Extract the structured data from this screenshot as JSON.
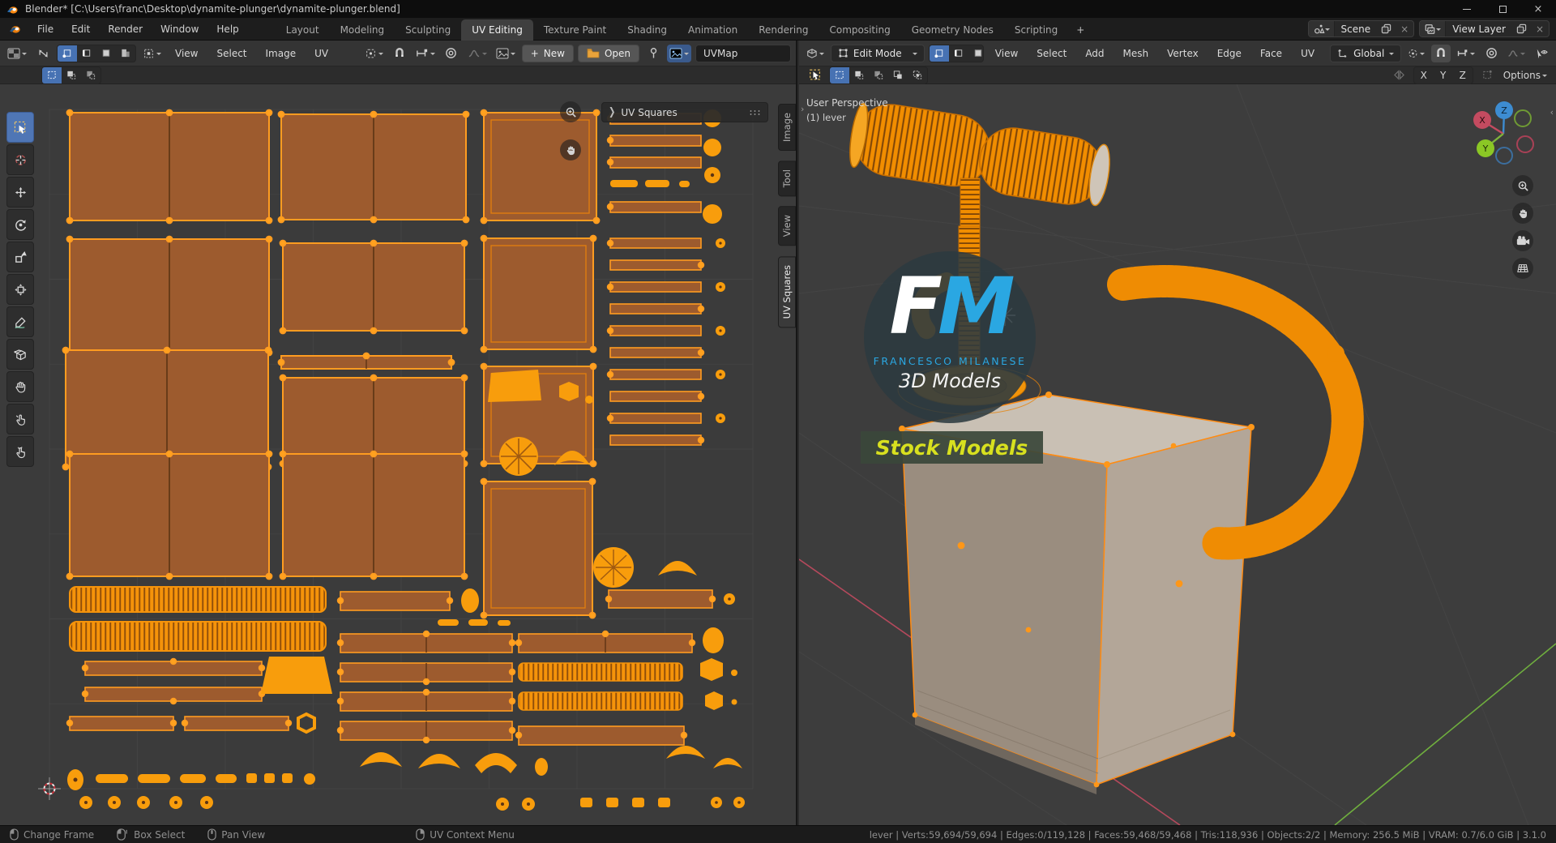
{
  "window": {
    "title": "Blender* [C:\\Users\\franc\\Desktop\\dynamite-plunger\\dynamite-plunger.blend]",
    "minimize": "–",
    "maximize": "",
    "close": "×"
  },
  "topbar": {
    "menus": [
      "File",
      "Edit",
      "Render",
      "Window",
      "Help"
    ],
    "workspaces": [
      "Layout",
      "Modeling",
      "Sculpting",
      "UV Editing",
      "Texture Paint",
      "Shading",
      "Animation",
      "Rendering",
      "Compositing",
      "Geometry Nodes",
      "Scripting"
    ],
    "active_workspace": "UV Editing",
    "add_workspace": "+",
    "scene_label": "Scene",
    "view_layer_label": "View Layer",
    "close_x": "×"
  },
  "uv_editor": {
    "menus": [
      "View",
      "Select",
      "Image",
      "UV"
    ],
    "new_label": "New",
    "plus": "+",
    "open_label": "Open",
    "uvmap_value": "UVMap",
    "panel_title": "UV Squares",
    "panel_chevron": "❯",
    "sidebar_tabs": [
      "Image",
      "Tool",
      "View",
      "UV Squares"
    ],
    "active_sidebar_tab": "UV Squares"
  },
  "viewport_3d": {
    "mode": "Edit Mode",
    "menus": [
      "View",
      "Select",
      "Add",
      "Mesh",
      "Vertex",
      "Edge",
      "Face",
      "UV"
    ],
    "orientation": "Global",
    "axis_toggles": [
      "X",
      "Y",
      "Z"
    ],
    "options_label": "Options",
    "toolbar_expand": "›",
    "sidebar_expand": "‹",
    "overlay": {
      "view_label": "User Perspective",
      "object_label": "(1) lever"
    },
    "gizmo": {
      "x": "X",
      "y": "Y",
      "z": "Z"
    },
    "watermark": {
      "f": "F",
      "m": "M",
      "name": "FRANCESCO MILANESE",
      "tagline": "3D Models",
      "badge": "Stock Models"
    }
  },
  "statusbar": {
    "hints": [
      {
        "label": "Change Frame"
      },
      {
        "label": "Box Select"
      },
      {
        "label": "Pan View"
      },
      {
        "label": "UV Context Menu"
      }
    ],
    "stats": "lever | Verts:59,694/59,694 | Edges:0/119,128 | Faces:59,468/59,468 | Tris:118,936 | Objects:2/2 | Memory: 256.5 MiB | VRAM: 0.7/6.0 GiB | 3.1.0"
  },
  "icons": {
    "dropdown-chevron": "⌄",
    "panel-collapse": "❯",
    "window-close": "×"
  },
  "colors": {
    "accent_blue": "#4772b3",
    "uv_orange": "#ff9c20",
    "uv_island_fill": "#9d5b2e",
    "viewport_bg": "#3b3b3b",
    "logo_blue": "#2aa7e2",
    "badge_yellow": "#d8e01f",
    "axis_x_red": "#c44b60",
    "axis_y_green": "#7fb43c",
    "axis_z_blue": "#3d8cd1"
  }
}
